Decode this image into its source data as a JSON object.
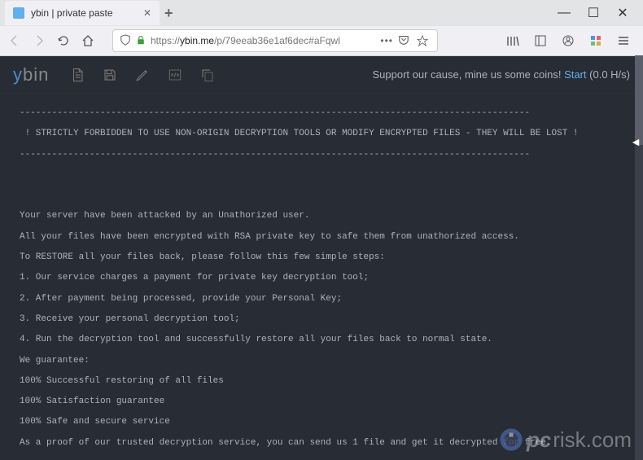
{
  "browser": {
    "tab": {
      "title": "ybin | private paste"
    },
    "url": {
      "protocol": "https://",
      "domain": "ybin.me",
      "path": "/p/79eeab36e1af6dec#aFqwl"
    },
    "window_controls": {
      "minimize": "—",
      "maximize": "☐",
      "close": "✕"
    }
  },
  "app": {
    "logo": {
      "first": "y",
      "rest": "bin"
    },
    "toolbar": {
      "new": "new-doc-icon",
      "save": "save-icon",
      "edit": "pencil-icon",
      "code": "code-icon",
      "copy": "copy-icon"
    },
    "support": {
      "text": "Support our cause, mine us some coins! ",
      "start_label": "Start",
      "rate": " (0.0 H/s)"
    }
  },
  "paste": {
    "lines": [
      "-----------------------------------------------------------------------------------------------",
      " ! STRICTLY FORBIDDEN TO USE NON-ORIGIN DECRYPTION TOOLS OR MODIFY ENCRYPTED FILES - THEY WILL BE LOST !",
      "-----------------------------------------------------------------------------------------------",
      "",
      "",
      "Your server have been attacked by an Unathorized user.",
      "All your files have been encrypted with RSA private key to safe them from unathorized access.",
      "To RESTORE all your files back, please follow this few simple steps:",
      "1. Our service charges a payment for private key decryption tool;",
      "2. After payment being processed, provide your Personal Key;",
      "3. Receive your personal decryption tool;",
      "4. Run the decryption tool and successfully restore all your files back to normal state.",
      "We guarantee:",
      "100% Successful restoring of all files",
      "100% Satisfaction guarantee",
      "100% Safe and secure service",
      "As a proof of our trusted decryption service, you can send us 1 file and get it decrypted for free."
    ]
  },
  "watermark": {
    "text": "risk.com",
    "prefix": "pc"
  }
}
